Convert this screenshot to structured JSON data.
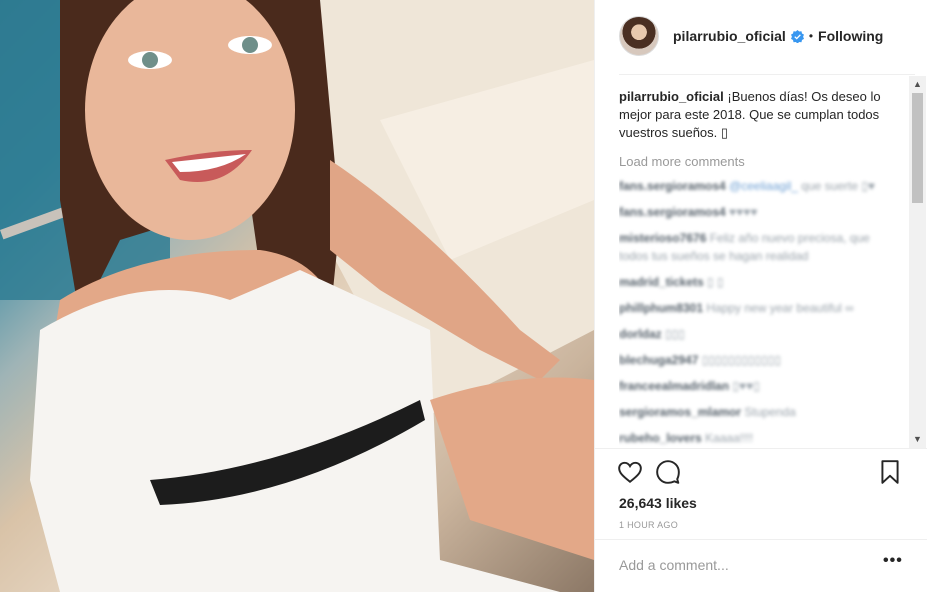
{
  "post": {
    "photo_alt": "photo-of-woman-on-boat"
  },
  "header": {
    "username": "pilarrubio_oficial",
    "separator": "•",
    "follow_status": "Following"
  },
  "caption": {
    "username": "pilarrubio_oficial",
    "text": "¡Buenos días! Os deseo lo mejor para este 2018. Que se cumplan todos vuestros sueños. ▯"
  },
  "load_more": "Load more comments",
  "comments": [
    {
      "user": "fans.sergioramos4",
      "mention": "@ceeliaagil_",
      "text": " que suerte ▯♥"
    },
    {
      "user": "fans.sergioramos4",
      "text": " ♥♥♥♥"
    },
    {
      "user": "misterioso7676",
      "text": " Feliz año nuevo preciosa, que todos tus sueños se hagan realidad"
    },
    {
      "user": "madrid_tickets",
      "text": " ▯ ▯"
    },
    {
      "user": "phillphum8301",
      "text": " Happy new year beautiful ∞"
    },
    {
      "user": "dorldaz",
      "text": " ▯▯▯"
    },
    {
      "user": "blechuga2947",
      "text": " ▯▯▯▯▯▯▯▯▯▯▯▯"
    },
    {
      "user": "franceealmadridlan",
      "text": " ▯♥♥▯"
    },
    {
      "user": "sergioramos_mlamor",
      "text": " Stupenda"
    },
    {
      "user": "rubeho_lovers",
      "text": " Kaaaa!!!!"
    }
  ],
  "actions": {
    "likes": "26,643 likes",
    "time": "1 HOUR AGO"
  },
  "add_comment": {
    "placeholder": "Add a comment...",
    "more_label": "•••"
  },
  "colors": {
    "text": "#262626",
    "muted": "#999999",
    "verified": "#3897f0",
    "border": "#efefef"
  }
}
